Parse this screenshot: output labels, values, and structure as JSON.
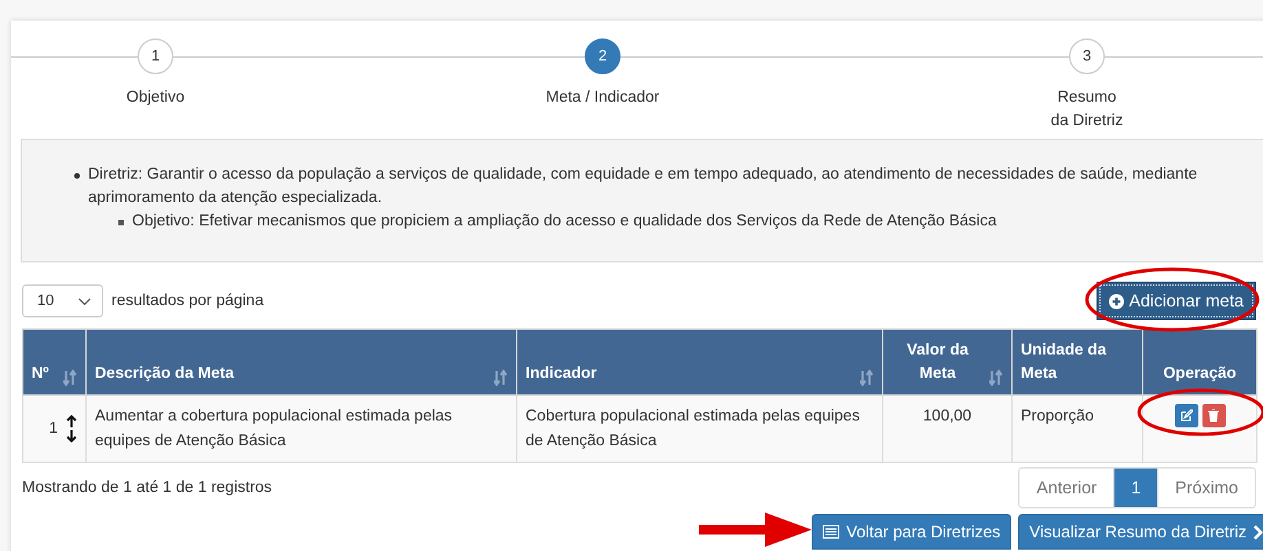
{
  "steps": [
    {
      "number": "1",
      "label": "Objetivo",
      "selected": false
    },
    {
      "number": "2",
      "label": "Meta / Indicador",
      "selected": true
    },
    {
      "number": "3",
      "label": "Resumo\nda Diretriz",
      "selected": false
    }
  ],
  "info": {
    "items": [
      {
        "text": "Diretriz: Garantir o acesso da população a serviços de qualidade, com equidade e em tempo adequado, ao atendimento de necessidades de saúde, mediante aprimoramento da atenção especializada.",
        "children": [
          {
            "text": "Objetivo: Efetivar mecanismos que propiciem a ampliação do acesso e qualidade dos Serviços da Rede de Atenção Básica"
          }
        ]
      }
    ]
  },
  "page_size": {
    "value": "10",
    "label": "resultados por página"
  },
  "add_button": "Adicionar meta",
  "table": {
    "columns": [
      {
        "label": "Nº",
        "sortable": true
      },
      {
        "label": "Descrição da Meta",
        "sortable": true
      },
      {
        "label": "Indicador",
        "sortable": true
      },
      {
        "label": "Valor da Meta",
        "sortable": true
      },
      {
        "label": "Unidade da Meta",
        "sortable": false
      },
      {
        "label": "Operação",
        "sortable": false
      }
    ],
    "rows": [
      {
        "number": "1",
        "description": "Aumentar a cobertura populacional estimada pelas equipes de Atenção Básica",
        "indicator": "Cobertura populacional estimada pelas equipes de Atenção Básica",
        "value": "100,00",
        "unit": "Proporção"
      }
    ]
  },
  "summary": "Mostrando de 1 até 1 de 1 registros",
  "pagination": {
    "items": [
      {
        "label": "Anterior",
        "selected": false
      },
      {
        "label": "1",
        "selected": true
      },
      {
        "label": "Próximo",
        "selected": false
      }
    ]
  },
  "buttons": [
    {
      "label": "Voltar para Diretrizes",
      "kind": "back"
    },
    {
      "label": "Visualizar Resumo da Diretriz",
      "kind": "next"
    }
  ]
}
